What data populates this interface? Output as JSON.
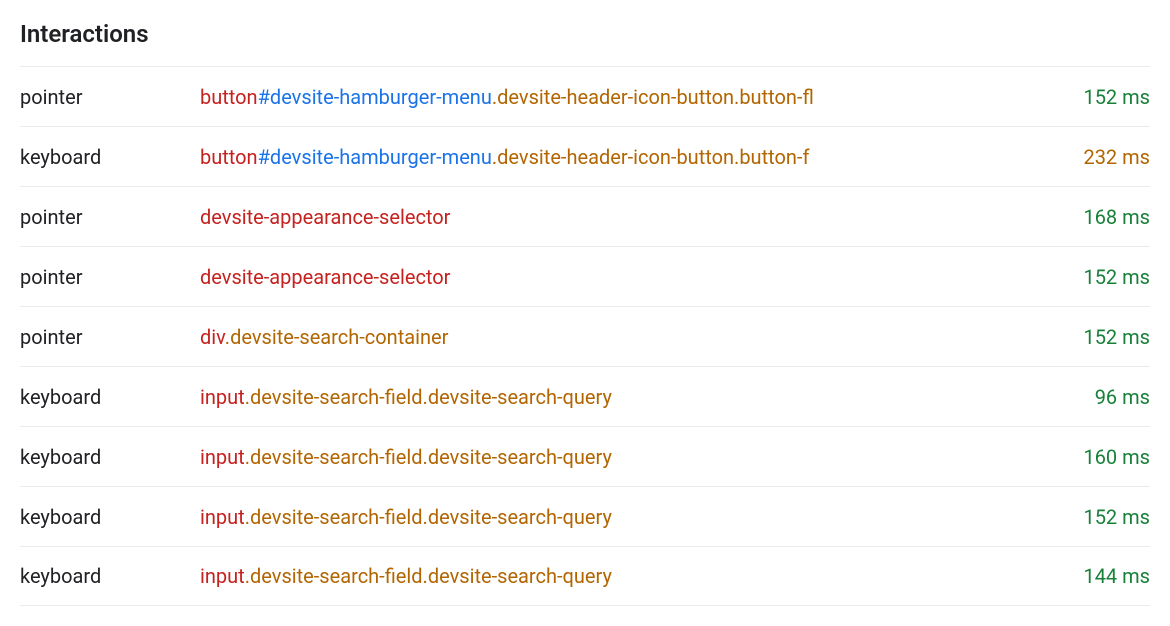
{
  "title": "Interactions",
  "rows": [
    {
      "type": "pointer",
      "parts": [
        {
          "kind": "tag",
          "text": "button"
        },
        {
          "kind": "id",
          "text": "#devsite-hamburger-menu"
        },
        {
          "kind": "cls",
          "text": ".devsite-header-icon-button.button-fl"
        }
      ],
      "duration": "152 ms",
      "durClass": "dur-green"
    },
    {
      "type": "keyboard",
      "parts": [
        {
          "kind": "tag",
          "text": "button"
        },
        {
          "kind": "id",
          "text": "#devsite-hamburger-menu"
        },
        {
          "kind": "cls",
          "text": ".devsite-header-icon-button.button-f"
        }
      ],
      "duration": "232 ms",
      "durClass": "dur-amber"
    },
    {
      "type": "pointer",
      "parts": [
        {
          "kind": "tag",
          "text": "devsite-appearance-selector"
        }
      ],
      "duration": "168 ms",
      "durClass": "dur-green"
    },
    {
      "type": "pointer",
      "parts": [
        {
          "kind": "tag",
          "text": "devsite-appearance-selector"
        }
      ],
      "duration": "152 ms",
      "durClass": "dur-green"
    },
    {
      "type": "pointer",
      "parts": [
        {
          "kind": "tag",
          "text": "div"
        },
        {
          "kind": "cls",
          "text": ".devsite-search-container"
        }
      ],
      "duration": "152 ms",
      "durClass": "dur-green"
    },
    {
      "type": "keyboard",
      "parts": [
        {
          "kind": "tag",
          "text": "input"
        },
        {
          "kind": "cls",
          "text": ".devsite-search-field.devsite-search-query"
        }
      ],
      "duration": "96 ms",
      "durClass": "dur-green"
    },
    {
      "type": "keyboard",
      "parts": [
        {
          "kind": "tag",
          "text": "input"
        },
        {
          "kind": "cls",
          "text": ".devsite-search-field.devsite-search-query"
        }
      ],
      "duration": "160 ms",
      "durClass": "dur-green"
    },
    {
      "type": "keyboard",
      "parts": [
        {
          "kind": "tag",
          "text": "input"
        },
        {
          "kind": "cls",
          "text": ".devsite-search-field.devsite-search-query"
        }
      ],
      "duration": "152 ms",
      "durClass": "dur-green"
    },
    {
      "type": "keyboard",
      "parts": [
        {
          "kind": "tag",
          "text": "input"
        },
        {
          "kind": "cls",
          "text": ".devsite-search-field.devsite-search-query"
        }
      ],
      "duration": "144 ms",
      "durClass": "dur-green"
    }
  ]
}
